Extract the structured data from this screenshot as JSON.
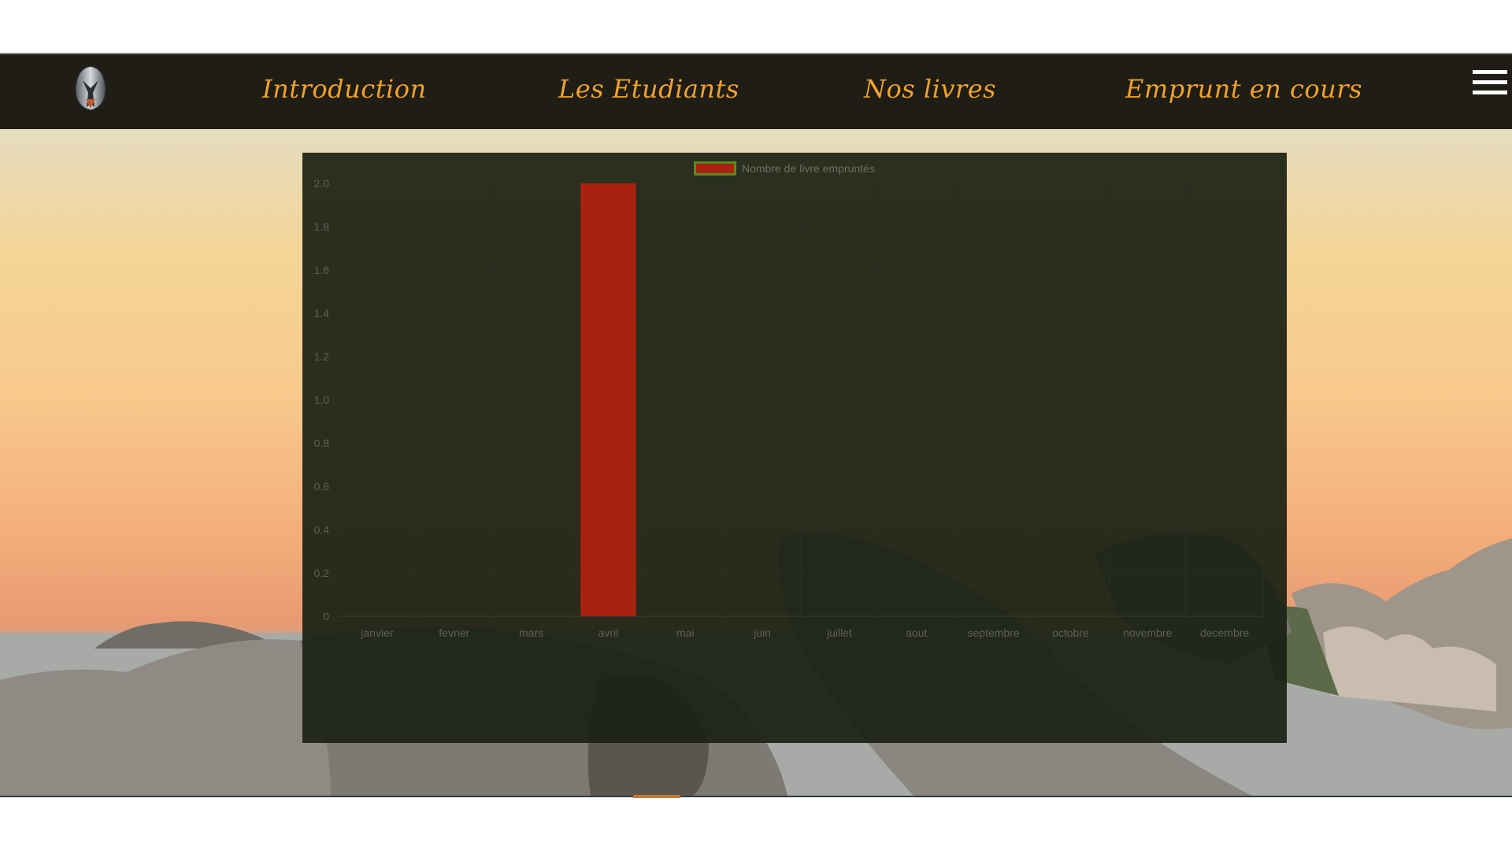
{
  "nav": {
    "items": [
      {
        "label": "Introduction"
      },
      {
        "label": "Les Etudiants"
      },
      {
        "label": "Nos livres"
      },
      {
        "label": "Emprunt en cours"
      }
    ],
    "logo_icon": "helmet-logo-icon",
    "menu_icon": "hamburger-menu-icon",
    "accent_color": "#f0a22a",
    "bar_color": "#1f1d15"
  },
  "background": {
    "image": "coastal-rocks-sunset"
  },
  "chart_data": {
    "type": "bar",
    "legend": "Nombre de livre empruntés",
    "categories": [
      "janvier",
      "fevrier",
      "mars",
      "avril",
      "mai",
      "juin",
      "juillet",
      "aout",
      "septembre",
      "octobre",
      "novembre",
      "decembre"
    ],
    "series": [
      {
        "name": "Nombre de livre empruntés",
        "values": [
          0,
          0,
          0,
          2,
          0,
          0,
          0,
          0,
          0,
          0,
          0,
          0
        ],
        "color": "#a8220f",
        "border_color": "#5a8a1a"
      }
    ],
    "yticks": [
      "0",
      "0.2",
      "0.4",
      "0.6",
      "0.8",
      "1.0",
      "1.2",
      "1.4",
      "1.6",
      "1.8",
      "2.0"
    ],
    "ylim": [
      0,
      2
    ],
    "grid": true,
    "legend_position": "top"
  }
}
